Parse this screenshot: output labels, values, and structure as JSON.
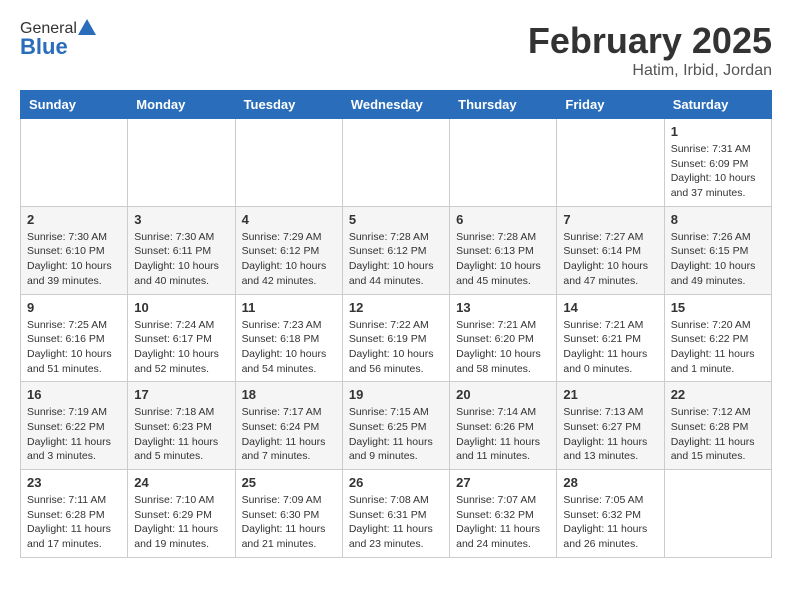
{
  "header": {
    "logo_general": "General",
    "logo_blue": "Blue",
    "title": "February 2025",
    "subtitle": "Hatim, Irbid, Jordan"
  },
  "days_of_week": [
    "Sunday",
    "Monday",
    "Tuesday",
    "Wednesday",
    "Thursday",
    "Friday",
    "Saturday"
  ],
  "weeks": [
    [
      {
        "day": "",
        "info": ""
      },
      {
        "day": "",
        "info": ""
      },
      {
        "day": "",
        "info": ""
      },
      {
        "day": "",
        "info": ""
      },
      {
        "day": "",
        "info": ""
      },
      {
        "day": "",
        "info": ""
      },
      {
        "day": "1",
        "info": "Sunrise: 7:31 AM\nSunset: 6:09 PM\nDaylight: 10 hours and 37 minutes."
      }
    ],
    [
      {
        "day": "2",
        "info": "Sunrise: 7:30 AM\nSunset: 6:10 PM\nDaylight: 10 hours and 39 minutes."
      },
      {
        "day": "3",
        "info": "Sunrise: 7:30 AM\nSunset: 6:11 PM\nDaylight: 10 hours and 40 minutes."
      },
      {
        "day": "4",
        "info": "Sunrise: 7:29 AM\nSunset: 6:12 PM\nDaylight: 10 hours and 42 minutes."
      },
      {
        "day": "5",
        "info": "Sunrise: 7:28 AM\nSunset: 6:12 PM\nDaylight: 10 hours and 44 minutes."
      },
      {
        "day": "6",
        "info": "Sunrise: 7:28 AM\nSunset: 6:13 PM\nDaylight: 10 hours and 45 minutes."
      },
      {
        "day": "7",
        "info": "Sunrise: 7:27 AM\nSunset: 6:14 PM\nDaylight: 10 hours and 47 minutes."
      },
      {
        "day": "8",
        "info": "Sunrise: 7:26 AM\nSunset: 6:15 PM\nDaylight: 10 hours and 49 minutes."
      }
    ],
    [
      {
        "day": "9",
        "info": "Sunrise: 7:25 AM\nSunset: 6:16 PM\nDaylight: 10 hours and 51 minutes."
      },
      {
        "day": "10",
        "info": "Sunrise: 7:24 AM\nSunset: 6:17 PM\nDaylight: 10 hours and 52 minutes."
      },
      {
        "day": "11",
        "info": "Sunrise: 7:23 AM\nSunset: 6:18 PM\nDaylight: 10 hours and 54 minutes."
      },
      {
        "day": "12",
        "info": "Sunrise: 7:22 AM\nSunset: 6:19 PM\nDaylight: 10 hours and 56 minutes."
      },
      {
        "day": "13",
        "info": "Sunrise: 7:21 AM\nSunset: 6:20 PM\nDaylight: 10 hours and 58 minutes."
      },
      {
        "day": "14",
        "info": "Sunrise: 7:21 AM\nSunset: 6:21 PM\nDaylight: 11 hours and 0 minutes."
      },
      {
        "day": "15",
        "info": "Sunrise: 7:20 AM\nSunset: 6:22 PM\nDaylight: 11 hours and 1 minute."
      }
    ],
    [
      {
        "day": "16",
        "info": "Sunrise: 7:19 AM\nSunset: 6:22 PM\nDaylight: 11 hours and 3 minutes."
      },
      {
        "day": "17",
        "info": "Sunrise: 7:18 AM\nSunset: 6:23 PM\nDaylight: 11 hours and 5 minutes."
      },
      {
        "day": "18",
        "info": "Sunrise: 7:17 AM\nSunset: 6:24 PM\nDaylight: 11 hours and 7 minutes."
      },
      {
        "day": "19",
        "info": "Sunrise: 7:15 AM\nSunset: 6:25 PM\nDaylight: 11 hours and 9 minutes."
      },
      {
        "day": "20",
        "info": "Sunrise: 7:14 AM\nSunset: 6:26 PM\nDaylight: 11 hours and 11 minutes."
      },
      {
        "day": "21",
        "info": "Sunrise: 7:13 AM\nSunset: 6:27 PM\nDaylight: 11 hours and 13 minutes."
      },
      {
        "day": "22",
        "info": "Sunrise: 7:12 AM\nSunset: 6:28 PM\nDaylight: 11 hours and 15 minutes."
      }
    ],
    [
      {
        "day": "23",
        "info": "Sunrise: 7:11 AM\nSunset: 6:28 PM\nDaylight: 11 hours and 17 minutes."
      },
      {
        "day": "24",
        "info": "Sunrise: 7:10 AM\nSunset: 6:29 PM\nDaylight: 11 hours and 19 minutes."
      },
      {
        "day": "25",
        "info": "Sunrise: 7:09 AM\nSunset: 6:30 PM\nDaylight: 11 hours and 21 minutes."
      },
      {
        "day": "26",
        "info": "Sunrise: 7:08 AM\nSunset: 6:31 PM\nDaylight: 11 hours and 23 minutes."
      },
      {
        "day": "27",
        "info": "Sunrise: 7:07 AM\nSunset: 6:32 PM\nDaylight: 11 hours and 24 minutes."
      },
      {
        "day": "28",
        "info": "Sunrise: 7:05 AM\nSunset: 6:32 PM\nDaylight: 11 hours and 26 minutes."
      },
      {
        "day": "",
        "info": ""
      }
    ]
  ]
}
